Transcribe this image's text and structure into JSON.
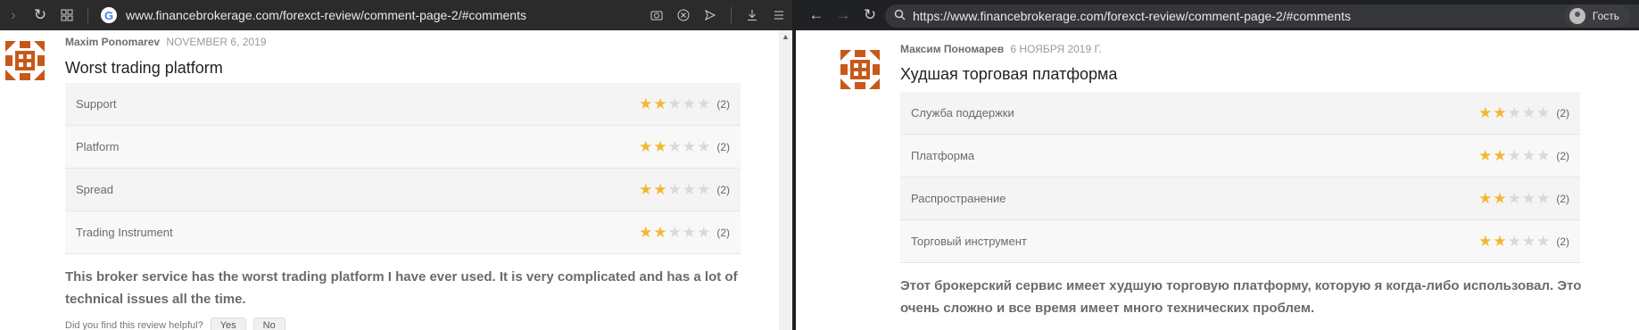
{
  "left_browser": {
    "url": "www.financebrokerage.com/forexct-review/comment-page-2/#comments",
    "icons": [
      "forward-icon",
      "reload-icon",
      "tabs-grid-icon",
      "google-icon",
      "camera-icon",
      "shield-icon",
      "send-icon",
      "download-icon",
      "menu-icon"
    ]
  },
  "right_browser": {
    "url": "https://www.financebrokerage.com/forexct-review/comment-page-2/#comments",
    "guest_label": "Гость"
  },
  "left_review": {
    "author": "Maxim Ponomarev",
    "date": "NOVEMBER 6, 2019",
    "title": "Worst trading platform",
    "ratings": [
      {
        "label": "Support",
        "stars": 2,
        "count": "(2)"
      },
      {
        "label": "Platform",
        "stars": 2,
        "count": "(2)"
      },
      {
        "label": "Spread",
        "stars": 2,
        "count": "(2)"
      },
      {
        "label": "Trading Instrument",
        "stars": 2,
        "count": "(2)"
      }
    ],
    "body": "This broker service has the worst trading platform I have ever used. It is very complicated and has a lot of technical issues all the time.",
    "helpful_prompt": "Did you find this review helpful?",
    "yes_label": "Yes",
    "no_label": "No"
  },
  "right_review": {
    "author": "Максим Пономарев",
    "date": "6 НОЯБРЯ 2019 Г.",
    "title": "Худшая торговая платформа",
    "ratings": [
      {
        "label": "Служба поддержки",
        "stars": 2,
        "count": "(2)"
      },
      {
        "label": "Платформа",
        "stars": 2,
        "count": "(2)"
      },
      {
        "label": "Распространение",
        "stars": 2,
        "count": "(2)"
      },
      {
        "label": "Торговый инструмент",
        "stars": 2,
        "count": "(2)"
      }
    ],
    "body": "Этот брокерский сервис имеет худшую торговую платформу, которую я когда-либо использовал. Это очень сложно и все время имеет много технических проблем."
  },
  "colors": {
    "star_on": "#f5b731",
    "star_off": "#d9d9d9",
    "avatar": "#c8581a"
  }
}
